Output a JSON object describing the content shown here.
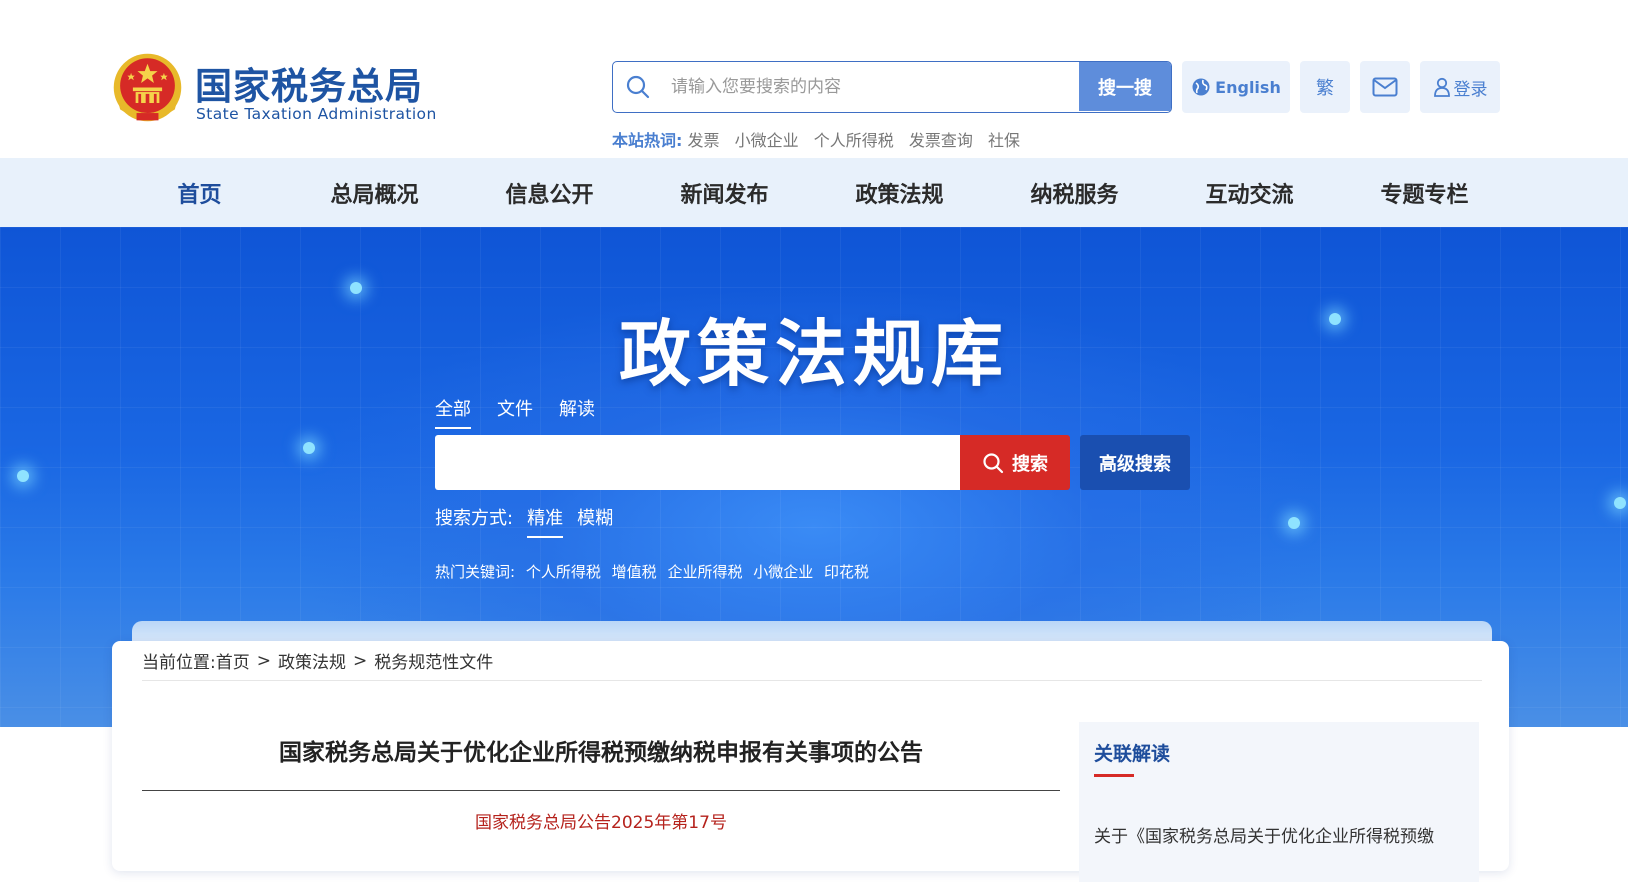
{
  "header": {
    "logo_cn": "国家税务总局",
    "logo_en": "State Taxation Administration",
    "search_placeholder": "请输入您要搜索的内容",
    "search_button": "搜一搜",
    "english": "English",
    "traditional": "繁",
    "login": "登录",
    "hot_label": "本站热词:",
    "hot_words": [
      "发票",
      "小微企业",
      "个人所得税",
      "发票查询",
      "社保"
    ]
  },
  "nav": {
    "items": [
      "首页",
      "总局概况",
      "信息公开",
      "新闻发布",
      "政策法规",
      "纳税服务",
      "互动交流",
      "专题专栏"
    ]
  },
  "banner": {
    "title": "政策法规库",
    "tabs": [
      "全部",
      "文件",
      "解读"
    ],
    "search_button": "搜索",
    "advanced": "高级搜索",
    "mode_label": "搜索方式:",
    "modes": [
      "精准",
      "模糊"
    ],
    "hot_label": "热门关键词:",
    "hot_words": [
      "个人所得税",
      "增值税",
      "企业所得税",
      "小微企业",
      "印花税"
    ]
  },
  "breadcrumb": {
    "label": "当前位置:",
    "items": [
      "首页",
      "政策法规",
      "税务规范性文件"
    ]
  },
  "document": {
    "title": "国家税务总局关于优化企业所得税预缴纳税申报有关事项的公告",
    "number": "国家税务总局公告2025年第17号"
  },
  "sidebar": {
    "heading": "关联解读",
    "item": "关于《国家税务总局关于优化企业所得税预缴"
  },
  "colors": {
    "brand_blue": "#1e54a3",
    "search_button": "#5e8ddb",
    "banner_search": "#d62a26",
    "advanced": "#1a4fb0",
    "doc_number": "#b5221c"
  }
}
